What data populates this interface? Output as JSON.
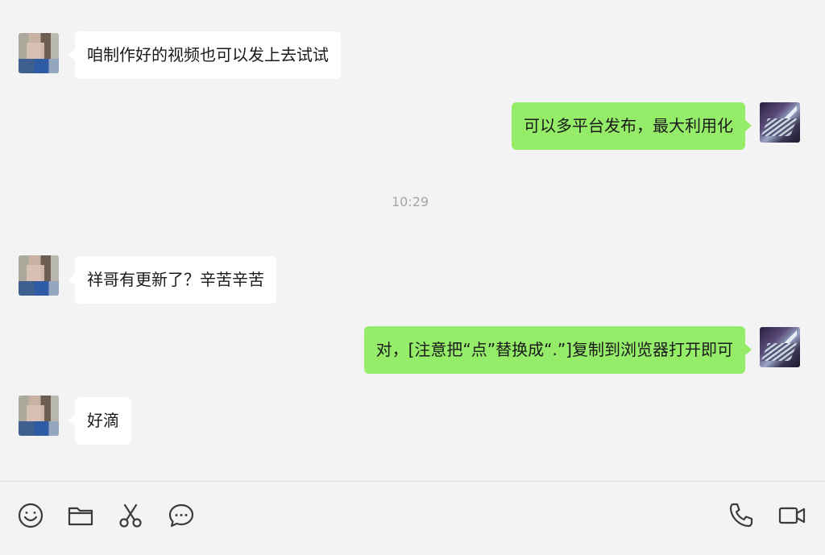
{
  "messages": [
    {
      "sender": "contact",
      "text": "咱制作好的视频也可以发上去试试"
    },
    {
      "sender": "self",
      "text": "可以多平台发布，最大利用化"
    },
    {
      "sender": "contact",
      "text": "祥哥有更新了？辛苦辛苦"
    },
    {
      "sender": "self",
      "text": "对，[注意把“点”替换成“.”]复制到浏览器打开即可"
    },
    {
      "sender": "contact",
      "text": "好滴"
    }
  ],
  "timestamp": "10:29",
  "colors": {
    "incoming_bubble": "#ffffff",
    "outgoing_bubble": "#95ec69",
    "background": "#f3f3f3",
    "timestamp_text": "#a6a6a6"
  },
  "toolbar": {
    "left_icons": [
      "emoji-icon",
      "folder-icon",
      "scissors-icon",
      "chat-bubble-icon"
    ],
    "right_icons": [
      "phone-icon",
      "video-camera-icon"
    ]
  }
}
